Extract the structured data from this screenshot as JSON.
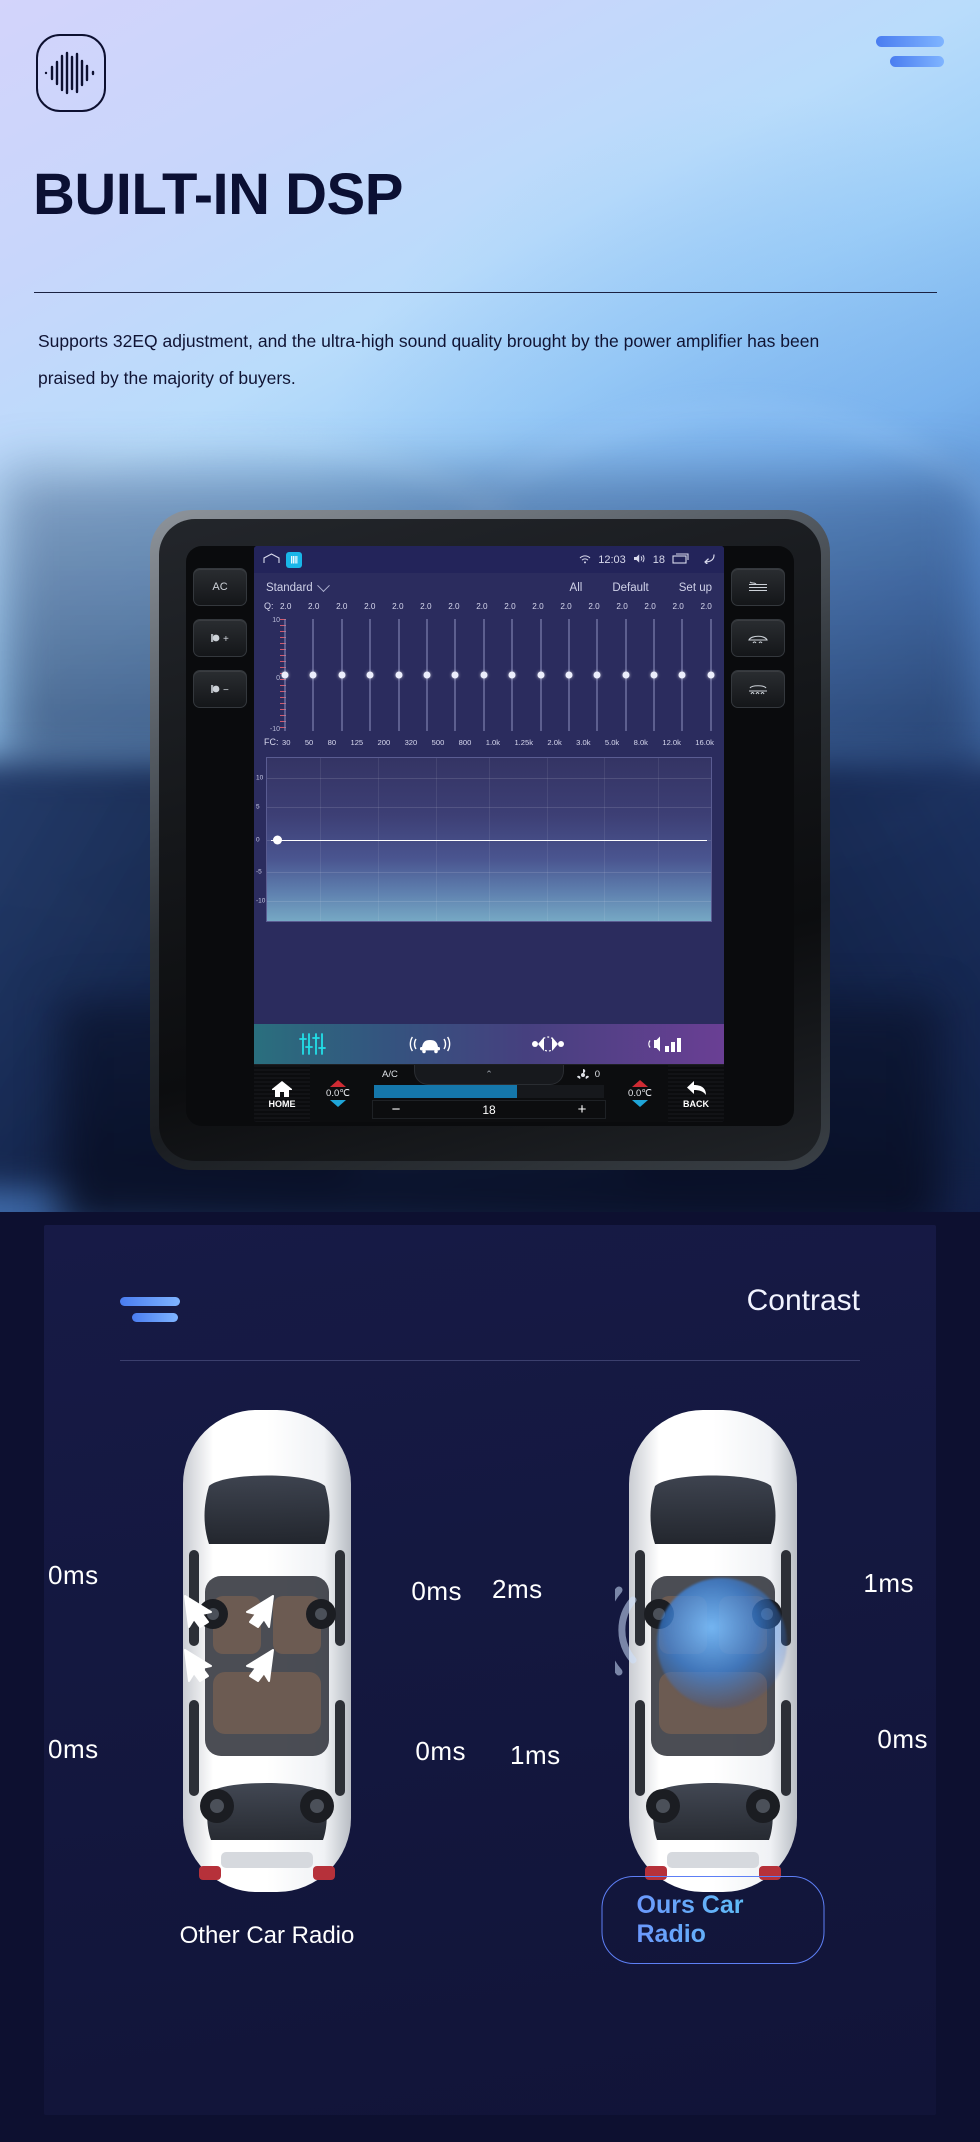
{
  "hero": {
    "logo_icon": "audio-waveform-icon",
    "menu_icon": "menu-lines-icon",
    "title": "BUILT-IN DSP",
    "paragraph": "Supports 32EQ adjustment, and the ultra-high sound quality brought by the power amplifier has been praised by the majority of buyers."
  },
  "radio": {
    "side_keys": {
      "ac": "AC",
      "fan_up": "fan-up-icon",
      "fan_down": "fan-down-icon"
    },
    "right_keys": {
      "rear_defog": "rear-defog-icon",
      "front_defog": "front-defog-icon",
      "defrost": "defrost-icon"
    },
    "statusbar": {
      "home_icon": "home-outline-icon",
      "app_badge": "app-icon",
      "wifi_icon": "wifi-icon",
      "time": "12:03",
      "volume_icon": "volume-icon",
      "volume_value": "18",
      "recents_icon": "recents-icon",
      "back_icon": "back-arrow-icon"
    },
    "eq": {
      "preset": "Standard",
      "preset_caret": "chevron-down-icon",
      "actions": [
        "All",
        "Default",
        "Set up"
      ],
      "q_label": "Q:",
      "q_values": [
        "2.0",
        "2.0",
        "2.0",
        "2.0",
        "2.0",
        "2.0",
        "2.0",
        "2.0",
        "2.0",
        "2.0",
        "2.0",
        "2.0",
        "2.0",
        "2.0",
        "2.0",
        "2.0"
      ],
      "fc_label": "FC:",
      "fc_values": [
        "30",
        "50",
        "80",
        "125",
        "200",
        "320",
        "500",
        "800",
        "1.0k",
        "1.25k",
        "2.0k",
        "3.0k",
        "5.0k",
        "8.0k",
        "12.0k",
        "16.0k"
      ],
      "slider_axis": [
        "10",
        "0",
        "-10"
      ],
      "curve_axis": [
        "10",
        "5",
        "0",
        "-5",
        "-10"
      ]
    },
    "tabs": [
      {
        "name": "equalizer-tab",
        "icon": "eq-sliders-icon",
        "active": true
      },
      {
        "name": "sound-field-tab",
        "icon": "car-soundfield-icon",
        "active": false
      },
      {
        "name": "balance-fader-tab",
        "icon": "balance-fader-icon",
        "active": false
      },
      {
        "name": "level-tab",
        "icon": "speaker-level-icon",
        "active": false
      }
    ],
    "hvac": {
      "home_label": "HOME",
      "back_label": "BACK",
      "left_temp": "0.0℃",
      "right_temp": "0.0℃",
      "ac_label": "A/C",
      "fan_icon": "fan-icon",
      "fan_value": "0",
      "minus_label": "−",
      "plus_label": "+",
      "fan_speed": "18"
    }
  },
  "contrast": {
    "menu_icon": "menu-lines-icon",
    "title": "Contrast",
    "left": {
      "label": "Other Car Radio",
      "front_left": "0ms",
      "front_right": "0ms",
      "rear_left": "0ms",
      "rear_right": "0ms"
    },
    "right": {
      "label": "Ours Car Radio",
      "front_left": "2ms",
      "front_right": "1ms",
      "rear_left": "1ms",
      "rear_right": "0ms"
    }
  },
  "colors": {
    "accent_blue": "#5d7ff5",
    "accent_cyan": "#57d7f2",
    "ink": "#0b1033",
    "panel_bg": "#141840",
    "screen_bg": "#2b2c5e"
  }
}
